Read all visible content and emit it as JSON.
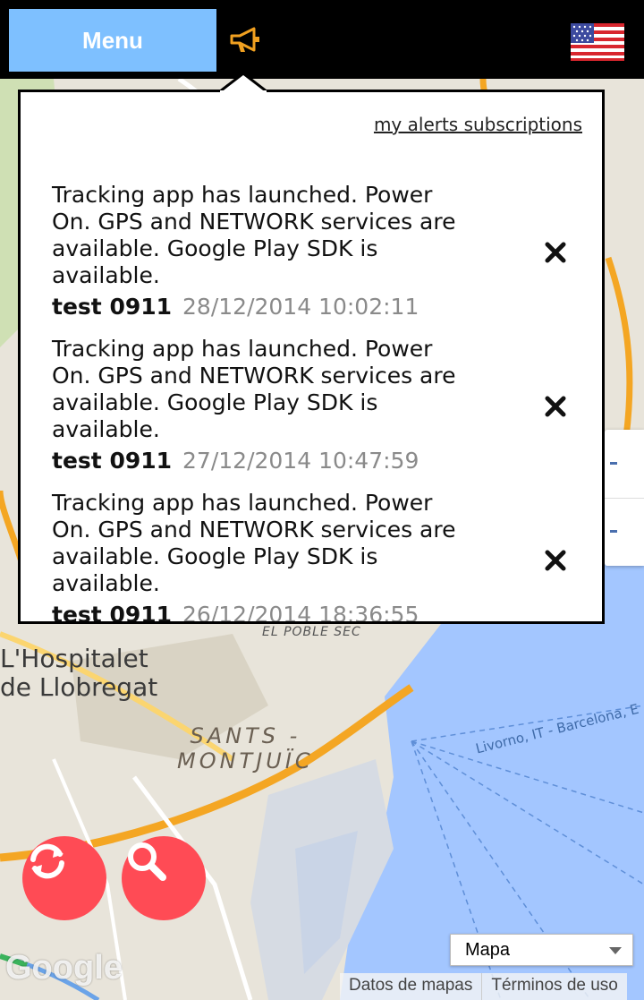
{
  "topbar": {
    "menu_label": "Menu",
    "announce_icon": "megaphone-icon",
    "language_icon": "us-flag-icon"
  },
  "popup": {
    "subscriptions_link": "my alerts subscriptions",
    "alerts": [
      {
        "message": "Tracking app has launched. Power On. GPS and NETWORK services are available. Google Play SDK is available.",
        "device": "test 0911",
        "timestamp": "28/12/2014 10:02:11"
      },
      {
        "message": "Tracking app has launched. Power On. GPS and NETWORK services are available. Google Play SDK is available.",
        "device": "test 0911",
        "timestamp": "27/12/2014 10:47:59"
      },
      {
        "message": "Tracking app has launched. Power On. GPS and NETWORK services are available. Google Play SDK is available.",
        "device": "test 0911",
        "timestamp": "26/12/2014 18:36:55"
      }
    ]
  },
  "map": {
    "labels": {
      "hospitalet_1": "L'Hospitalet",
      "hospitalet_2": "de Llobregat",
      "sants_1": "SANTS -",
      "sants_2": "MONTJUÏC",
      "poble_sec": "EL POBLE SEC",
      "route": "Livorno, IT - Barcelona, E"
    },
    "map_type_selected": "Mapa",
    "footer": {
      "map_data": "Datos de mapas",
      "terms": "Términos de uso"
    },
    "logo": "Google"
  },
  "colors": {
    "menu_button": "#7ec0ff",
    "fab": "#ff4b55",
    "water": "#a3c6ff",
    "land": "#e8e4da"
  }
}
